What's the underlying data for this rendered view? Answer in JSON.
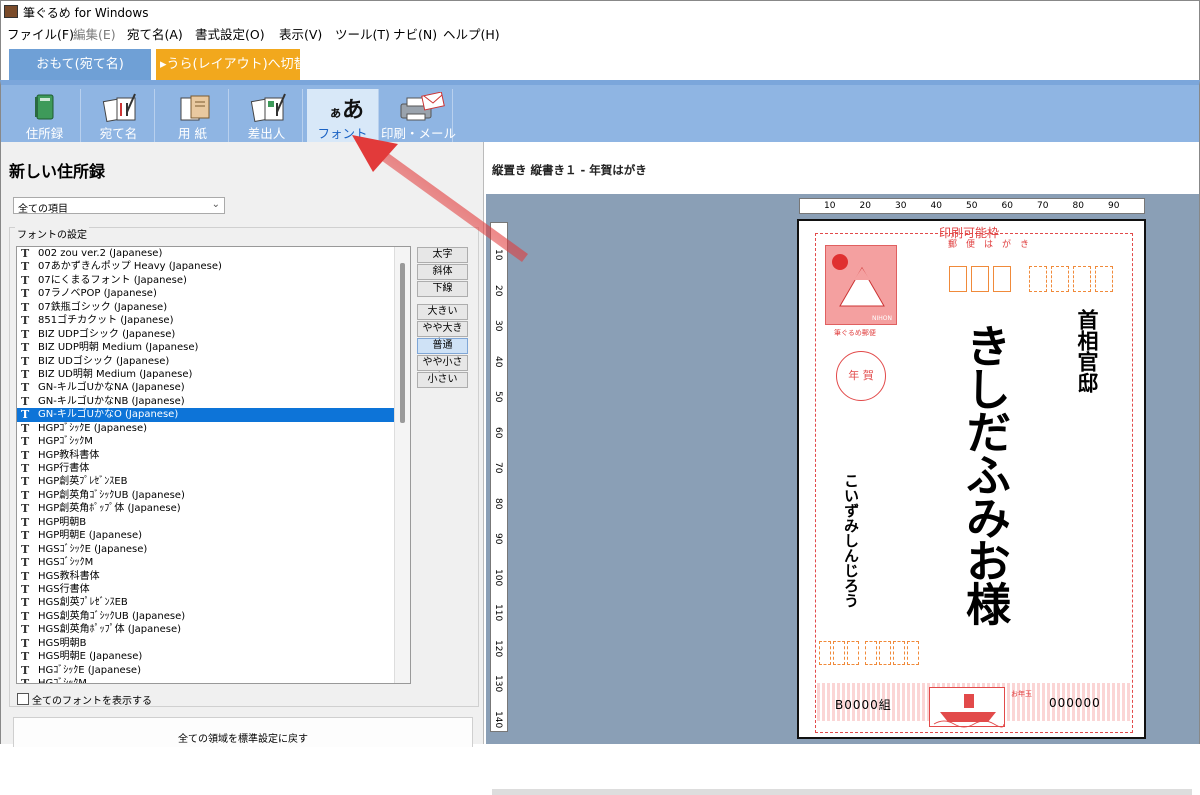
{
  "window": {
    "title": "筆ぐるめ for Windows"
  },
  "menu": [
    {
      "label": "ファイル(F)",
      "enabled": true
    },
    {
      "label": "編集(E)",
      "enabled": false
    },
    {
      "label": "宛て名(A)",
      "enabled": true
    },
    {
      "label": "書式設定(O)",
      "enabled": true
    },
    {
      "label": "表示(V)",
      "enabled": true
    },
    {
      "label": "ツール(T)",
      "enabled": true
    },
    {
      "label": "ナビ(N)",
      "enabled": true
    },
    {
      "label": "ヘルプ(H)",
      "enabled": true
    }
  ],
  "tabs": {
    "omote": "おもて(宛て名)",
    "ura": "▸うら(レイアウト)へ切替"
  },
  "toolbar": [
    {
      "label": "住所録",
      "icon": "address-book-icon"
    },
    {
      "label": "宛て名",
      "icon": "address-card-icon"
    },
    {
      "label": "用 紙",
      "icon": "paper-icon"
    },
    {
      "label": "差出人",
      "icon": "sender-icon"
    },
    {
      "label": "フォント",
      "icon": "font-icon",
      "glyph_small": "ぁ",
      "glyph_big": "あ",
      "selected": true
    },
    {
      "label": "印刷・メール",
      "icon": "printer-mail-icon"
    }
  ],
  "left": {
    "title": "新しい住所録",
    "filter": "全ての項目",
    "group_label": "フォントの設定",
    "fonts": [
      "002 zou ver.2 (Japanese)",
      "07あかずきんポップ Heavy (Japanese)",
      "07にくまるフォント (Japanese)",
      "07ラノベPOP (Japanese)",
      "07鉄瓶ゴシック (Japanese)",
      "851ゴチカクット (Japanese)",
      "BIZ UDPゴシック (Japanese)",
      "BIZ UDP明朝 Medium (Japanese)",
      "BIZ UDゴシック (Japanese)",
      "BIZ UD明朝 Medium (Japanese)",
      "GN-キルゴUかなNA (Japanese)",
      "GN-キルゴUかなNB (Japanese)",
      "GN-キルゴUかなO (Japanese)",
      "HGPｺﾞｼｯｸE (Japanese)",
      "HGPｺﾞｼｯｸM",
      "HGP教科書体",
      "HGP行書体",
      "HGP創英ﾌﾟﾚｾﾞﾝｽEB",
      "HGP創英角ｺﾞｼｯｸUB (Japanese)",
      "HGP創英角ﾎﾟｯﾌﾟ体 (Japanese)",
      "HGP明朝B",
      "HGP明朝E (Japanese)",
      "HGSｺﾞｼｯｸE (Japanese)",
      "HGSｺﾞｼｯｸM",
      "HGS教科書体",
      "HGS行書体",
      "HGS創英ﾌﾟﾚｾﾞﾝｽEB",
      "HGS創英角ｺﾞｼｯｸUB (Japanese)",
      "HGS創英角ﾎﾟｯﾌﾟ体 (Japanese)",
      "HGS明朝B",
      "HGS明朝E (Japanese)",
      "HGｺﾞｼｯｸE (Japanese)",
      "HGｺﾞｼｯｸM"
    ],
    "selected_font_index": 12,
    "style_buttons": [
      "太字",
      "斜体",
      "下線"
    ],
    "size_buttons": [
      "大きい",
      "やや大きい",
      "普通",
      "やや小さい",
      "小さい"
    ],
    "selected_size_index": 2,
    "show_all_fonts": "全てのフォントを表示する",
    "reset_button": "全ての領域を標準設定に戻す"
  },
  "right": {
    "title": "縦置き 縦書き１ - 年賀はがき",
    "ruler_h": [
      "10",
      "20",
      "30",
      "40",
      "50",
      "60",
      "70",
      "80",
      "90"
    ],
    "ruler_v": [
      "10",
      "20",
      "30",
      "40",
      "50",
      "60",
      "70",
      "80",
      "90",
      "100",
      "110",
      "120",
      "130",
      "140"
    ],
    "postcard": {
      "printable_label": "印刷可能枠",
      "kana": "郵便はがき",
      "stamp_caption": "筆ぐるめ郵便",
      "stamp_brand": "NIHON",
      "cancel_mark": "年 賀",
      "recipient_name": "きしだふみお様",
      "recipient_address": "首相官邸",
      "sender_name": "こいずみしんじろう",
      "lottery_left": "B0000組",
      "lottery_right": "000000",
      "otoshidama": "お年玉"
    }
  },
  "colors": {
    "accent_blue": "#8fb5e3",
    "tab_blue": "#6fa0d6",
    "tab_orange": "#f2a81d",
    "selection": "#0d74d8",
    "annotation_red": "#e23a3a"
  }
}
